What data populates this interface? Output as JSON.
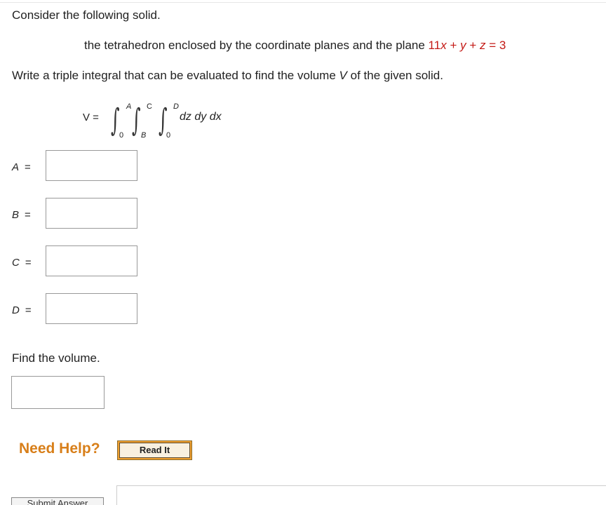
{
  "question": {
    "intro": "Consider the following solid.",
    "solid_prefix": "the tetrahedron enclosed by the coordinate planes and the plane",
    "plane": {
      "coef_x": "11",
      "var_x": "x",
      "plus1": "+",
      "var_y": "y",
      "plus2": "+",
      "var_z": "z",
      "eq": "=",
      "rhs": "3"
    },
    "instruction_prefix": "Write a triple integral that can be evaluated to find the volume",
    "instruction_var": "V",
    "instruction_suffix": "of the given solid."
  },
  "integral": {
    "v_label": "V =",
    "sign": "∫",
    "upper_1": "A",
    "lower_1": "0",
    "upper_2": "C",
    "lower_2": "B",
    "upper_3": "D",
    "lower_3": "0",
    "differentials": "dz dy dx"
  },
  "answers": [
    {
      "label": "A",
      "eq": "=",
      "value": ""
    },
    {
      "label": "B",
      "eq": "=",
      "value": ""
    },
    {
      "label": "C",
      "eq": "=",
      "value": ""
    },
    {
      "label": "D",
      "eq": "=",
      "value": ""
    }
  ],
  "volume": {
    "prompt": "Find the volume.",
    "value": ""
  },
  "help": {
    "need_help": "Need Help?",
    "read_it": "Read It"
  },
  "submit_label": "Submit Answer",
  "colors": {
    "accent_red": "#c41a16",
    "need_help_orange": "#d87f1a",
    "read_it_border": "#f0a030"
  }
}
